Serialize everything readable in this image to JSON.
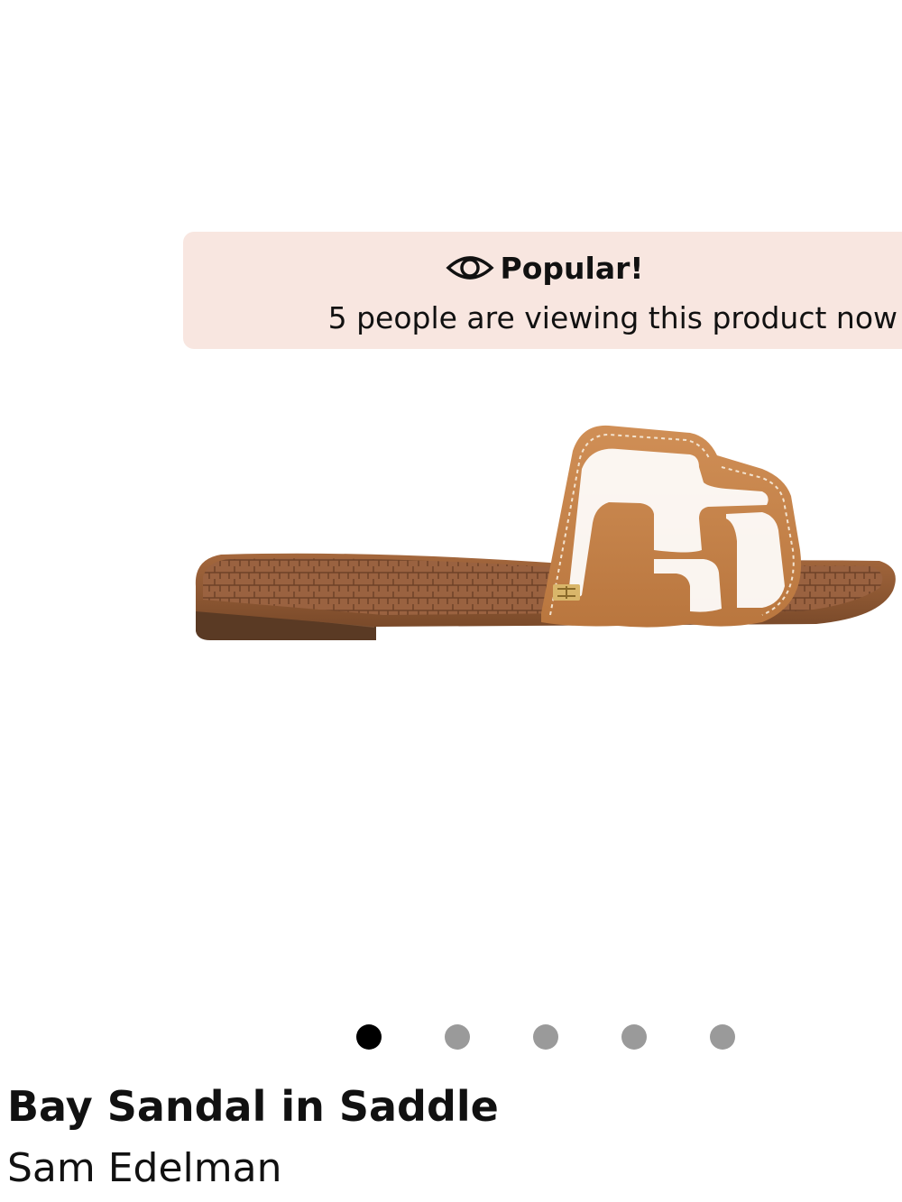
{
  "banner": {
    "icon": "eye-icon",
    "title": "Popular!",
    "message": "5 people are viewing this product now",
    "background_color": "#f8e6e0"
  },
  "gallery": {
    "image_subject": "sandal-product-photo",
    "dots": [
      {
        "active": true
      },
      {
        "active": false
      },
      {
        "active": false
      },
      {
        "active": false
      },
      {
        "active": false
      }
    ],
    "active_dot_color": "#000000",
    "inactive_dot_color": "#9a9a9a"
  },
  "product": {
    "title": "Bay Sandal in Saddle",
    "brand": "Sam Edelman"
  }
}
